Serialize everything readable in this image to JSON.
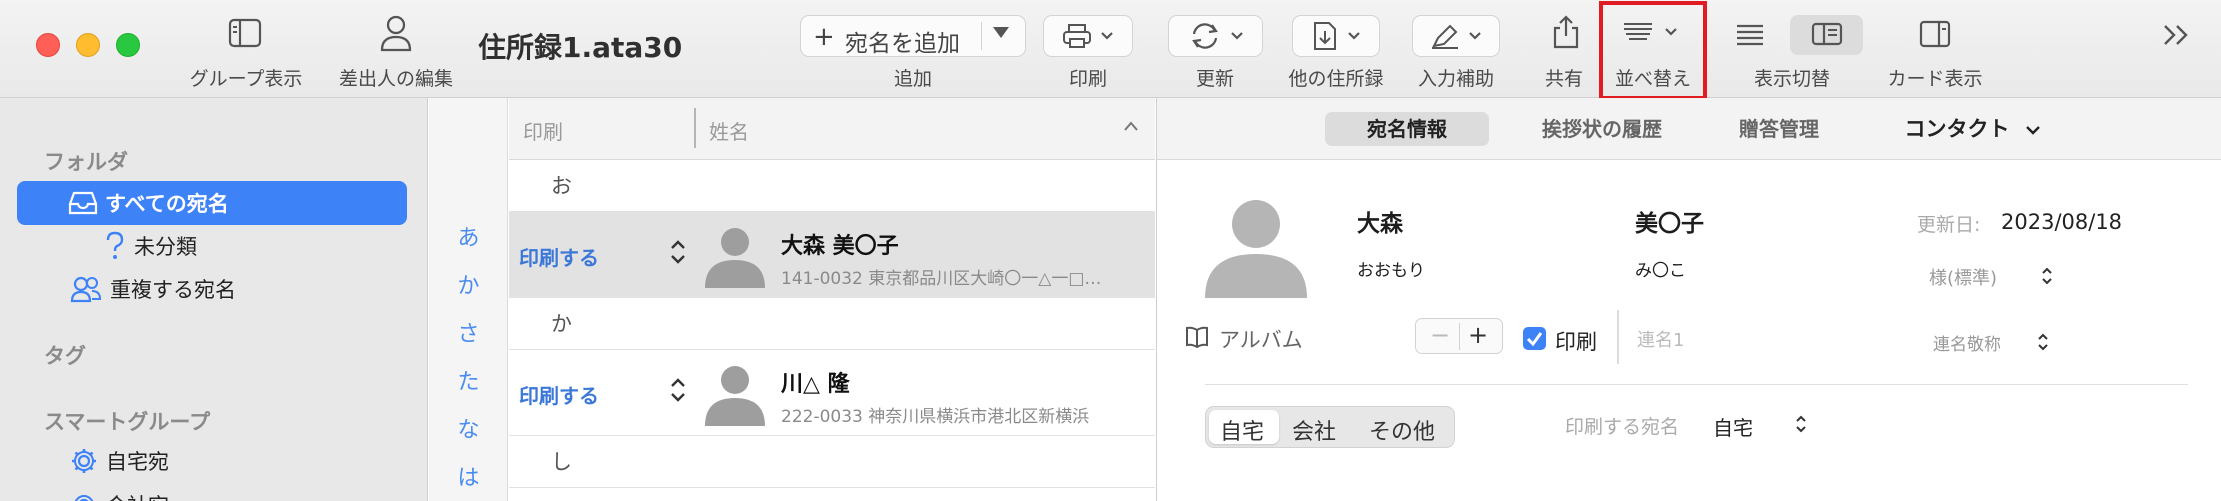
{
  "window": {
    "title": "住所録1.ata30"
  },
  "toolbar": {
    "group_view_label": "グループ表示",
    "sender_edit_label": "差出人の編集",
    "add_button_label": "宛名を追加",
    "add_label": "追加",
    "print_label": "印刷",
    "update_label": "更新",
    "other_address_book_label": "他の住所録",
    "input_assist_label": "入力補助",
    "share_label": "共有",
    "sort_label": "並べ替え",
    "view_switch_label": "表示切替",
    "card_view_label": "カード表示",
    "highlighted_item": "並べ替え"
  },
  "sidebar": {
    "folders_heading": "フォルダ",
    "items": [
      {
        "label": "すべての宛名",
        "selected": true,
        "icon": "tray-icon"
      },
      {
        "label": "未分類",
        "selected": false,
        "icon": "question-icon"
      },
      {
        "label": "重複する宛名",
        "selected": false,
        "icon": "people-icon"
      }
    ],
    "tags_heading": "タグ",
    "smart_groups_heading": "スマートグループ",
    "smart_items": [
      {
        "label": "自宅宛",
        "icon": "gear-icon"
      },
      {
        "label": "会社宛",
        "icon": "gear-icon"
      }
    ]
  },
  "index": [
    "あ",
    "か",
    "さ",
    "た",
    "な",
    "は"
  ],
  "list": {
    "header_print": "印刷",
    "header_name": "姓名",
    "groups": [
      {
        "label": "お"
      },
      {
        "label": "か"
      },
      {
        "label": "し"
      }
    ],
    "rows": [
      {
        "print": "印刷する",
        "name": "大森 美〇子",
        "address": "141-0032 東京都品川区大崎〇一△一□…",
        "selected": true
      },
      {
        "print": "印刷する",
        "name": "川△ 隆",
        "address": "222-0033 神奈川県横浜市港北区新横浜",
        "selected": false
      }
    ]
  },
  "detail": {
    "tabs": [
      {
        "label": "宛名情報",
        "active": true
      },
      {
        "label": "挨拶状の履歴",
        "active": false
      },
      {
        "label": "贈答管理",
        "active": false
      },
      {
        "label": "コンタクト",
        "active": false
      }
    ],
    "last_name": "大森",
    "first_name": "美〇子",
    "last_name_kana": "おおもり",
    "first_name_kana": "み〇こ",
    "updated_label": "更新日:",
    "updated_date": "2023/08/18",
    "honorific": "様(標準)",
    "album_label": "アルバム",
    "stepper_minus": "−",
    "stepper_plus": "+",
    "print_checkbox_label": "印刷",
    "print_checked": true,
    "joint_name_placeholder": "連名1",
    "joint_honorific": "連名敬称",
    "address_tabs": [
      "自宅",
      "会社",
      "その他"
    ],
    "address_tab_selected": "自宅",
    "print_address_label": "印刷する宛名",
    "print_address_value": "自宅"
  },
  "colors": {
    "accent": "#3e82f7",
    "highlight_box": "#e01b22",
    "print_link": "#3b78d8"
  }
}
